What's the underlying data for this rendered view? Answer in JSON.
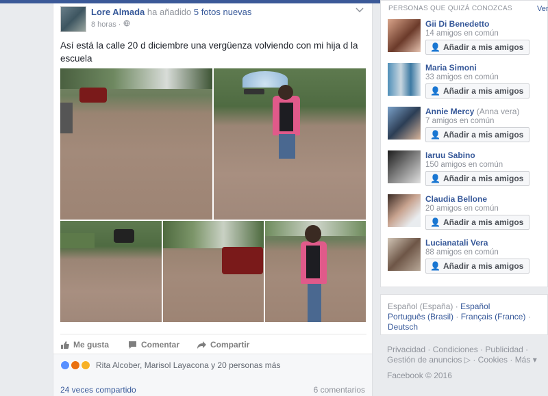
{
  "post": {
    "author": "Lore Almada",
    "action_text": "ha añadido",
    "photos_link": "5 fotos nuevas",
    "time": "8 horas",
    "privacy_sep": "·",
    "text": "Así está la calle 20 d diciembre una vergüenza volviendo con mi hija d la escuela",
    "actions": {
      "like": "Me gusta",
      "comment": "Comentar",
      "share": "Compartir"
    },
    "reactions_text": "Rita Alcober, Marisol Layacona y 20 personas más",
    "shares": "24 veces compartido",
    "comments": "6 comentarios"
  },
  "sidebar": {
    "title": "PERSONAS QUE QUIZÁ CONOZCAS",
    "more": "Ver",
    "add_label": "Añadir a mis amigos",
    "people": [
      {
        "name": "Gii Di Benedetto",
        "alt": "",
        "mutual": "14 amigos en común"
      },
      {
        "name": "Maria Simoni",
        "alt": "",
        "mutual": "33 amigos en común"
      },
      {
        "name": "Annie Mercy",
        "alt": "(Anna vera)",
        "mutual": "7 amigos en común"
      },
      {
        "name": "Iaruu Sabino",
        "alt": "",
        "mutual": "150 amigos en común"
      },
      {
        "name": "Claudia Bellone",
        "alt": "",
        "mutual": "20 amigos en común"
      },
      {
        "name": "Lucianatali Vera",
        "alt": "",
        "mutual": "88 amigos en común"
      }
    ]
  },
  "languages": {
    "current": "Español (España)",
    "options": [
      "Español",
      "Português (Brasil)",
      "Français (France)",
      "Deutsch"
    ]
  },
  "footer": {
    "links": [
      "Privacidad",
      "Condiciones",
      "Publicidad",
      "Gestión de anuncios",
      "Cookies",
      "Más"
    ],
    "copyright": "Facebook © 2016"
  },
  "colors": {
    "brand": "#3b5998",
    "link": "#365899",
    "muted": "#90949c"
  }
}
